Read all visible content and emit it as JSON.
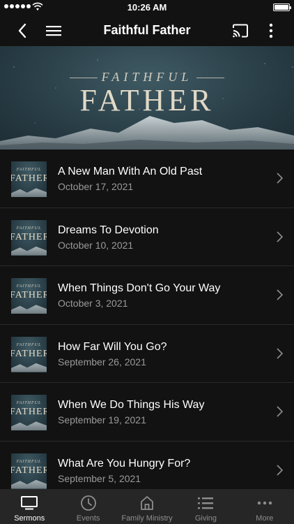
{
  "status_bar": {
    "time": "10:26 AM"
  },
  "nav": {
    "title": "Faithful Father"
  },
  "banner": {
    "small_title": "FAITHFUL",
    "big_title": "FATHER"
  },
  "thumbnail": {
    "small_title": "FAITHFUL",
    "big_title": "FATHER"
  },
  "sermons": [
    {
      "title": "A New Man With An Old Past",
      "date": "October 17, 2021"
    },
    {
      "title": "Dreams To Devotion",
      "date": "October 10, 2021"
    },
    {
      "title": "When Things Don't Go Your Way",
      "date": "October 3, 2021"
    },
    {
      "title": "How Far Will You Go?",
      "date": "September 26, 2021"
    },
    {
      "title": "When We Do Things His Way",
      "date": "September 19, 2021"
    },
    {
      "title": "What Are You Hungry For?",
      "date": "September 5, 2021"
    }
  ],
  "tabs": [
    {
      "label": "Sermons",
      "icon": "tv-icon",
      "active": true
    },
    {
      "label": "Events",
      "icon": "clock-icon",
      "active": false
    },
    {
      "label": "Family Ministry",
      "icon": "home-icon",
      "active": false
    },
    {
      "label": "Giving",
      "icon": "list-icon",
      "active": false
    },
    {
      "label": "More",
      "icon": "more-horizontal-icon",
      "active": false
    }
  ],
  "colors": {
    "background": "#121212",
    "tab_bar": "#262626",
    "inactive": "#8e8e8e",
    "active": "#ffffff"
  }
}
